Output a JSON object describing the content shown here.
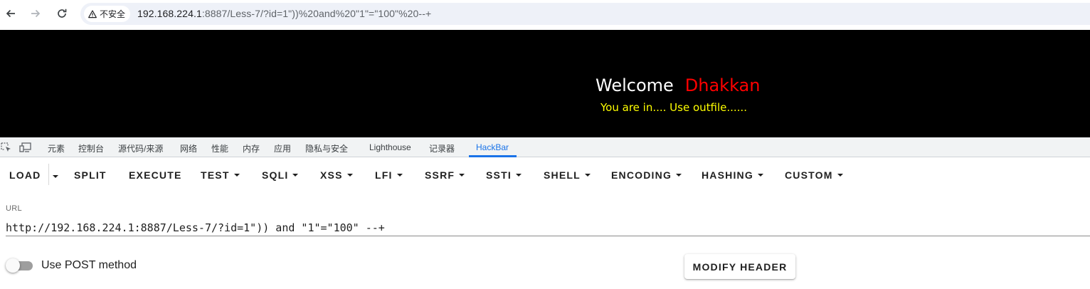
{
  "browser": {
    "security_label": "不安全",
    "url_host": "192.168.224.1",
    "url_rest": ":8887/Less-7/?id=1\"))%20and%20\"1\"=\"100\"%20--+"
  },
  "page": {
    "welcome": "Welcome",
    "user": "Dhakkan",
    "status": "You are in.... Use outfile......"
  },
  "devtools": {
    "tabs": [
      "元素",
      "控制台",
      "源代码/来源",
      "网络",
      "性能",
      "内存",
      "应用",
      "隐私与安全",
      "Lighthouse",
      "记录器",
      "HackBar"
    ],
    "active_tab": "HackBar"
  },
  "hackbar": {
    "toolbar": {
      "load": "LOAD",
      "split": "SPLIT",
      "execute": "EXECUTE",
      "test": "TEST",
      "sqli": "SQLI",
      "xss": "XSS",
      "lfi": "LFI",
      "ssrf": "SSRF",
      "ssti": "SSTI",
      "shell": "SHELL",
      "encoding": "ENCODING",
      "hashing": "HASHING",
      "custom": "CUSTOM"
    },
    "url_label": "URL",
    "url_value": "http://192.168.224.1:8887/Less-7/?id=1\")) and \"1\"=\"100\" --+",
    "post_label": "Use POST method",
    "post_enabled": false,
    "modify_header": "MODIFY HEADER"
  },
  "colors": {
    "accent": "#1a73e8",
    "welcome_user": "#ff0000",
    "status_text": "#ffff00"
  }
}
